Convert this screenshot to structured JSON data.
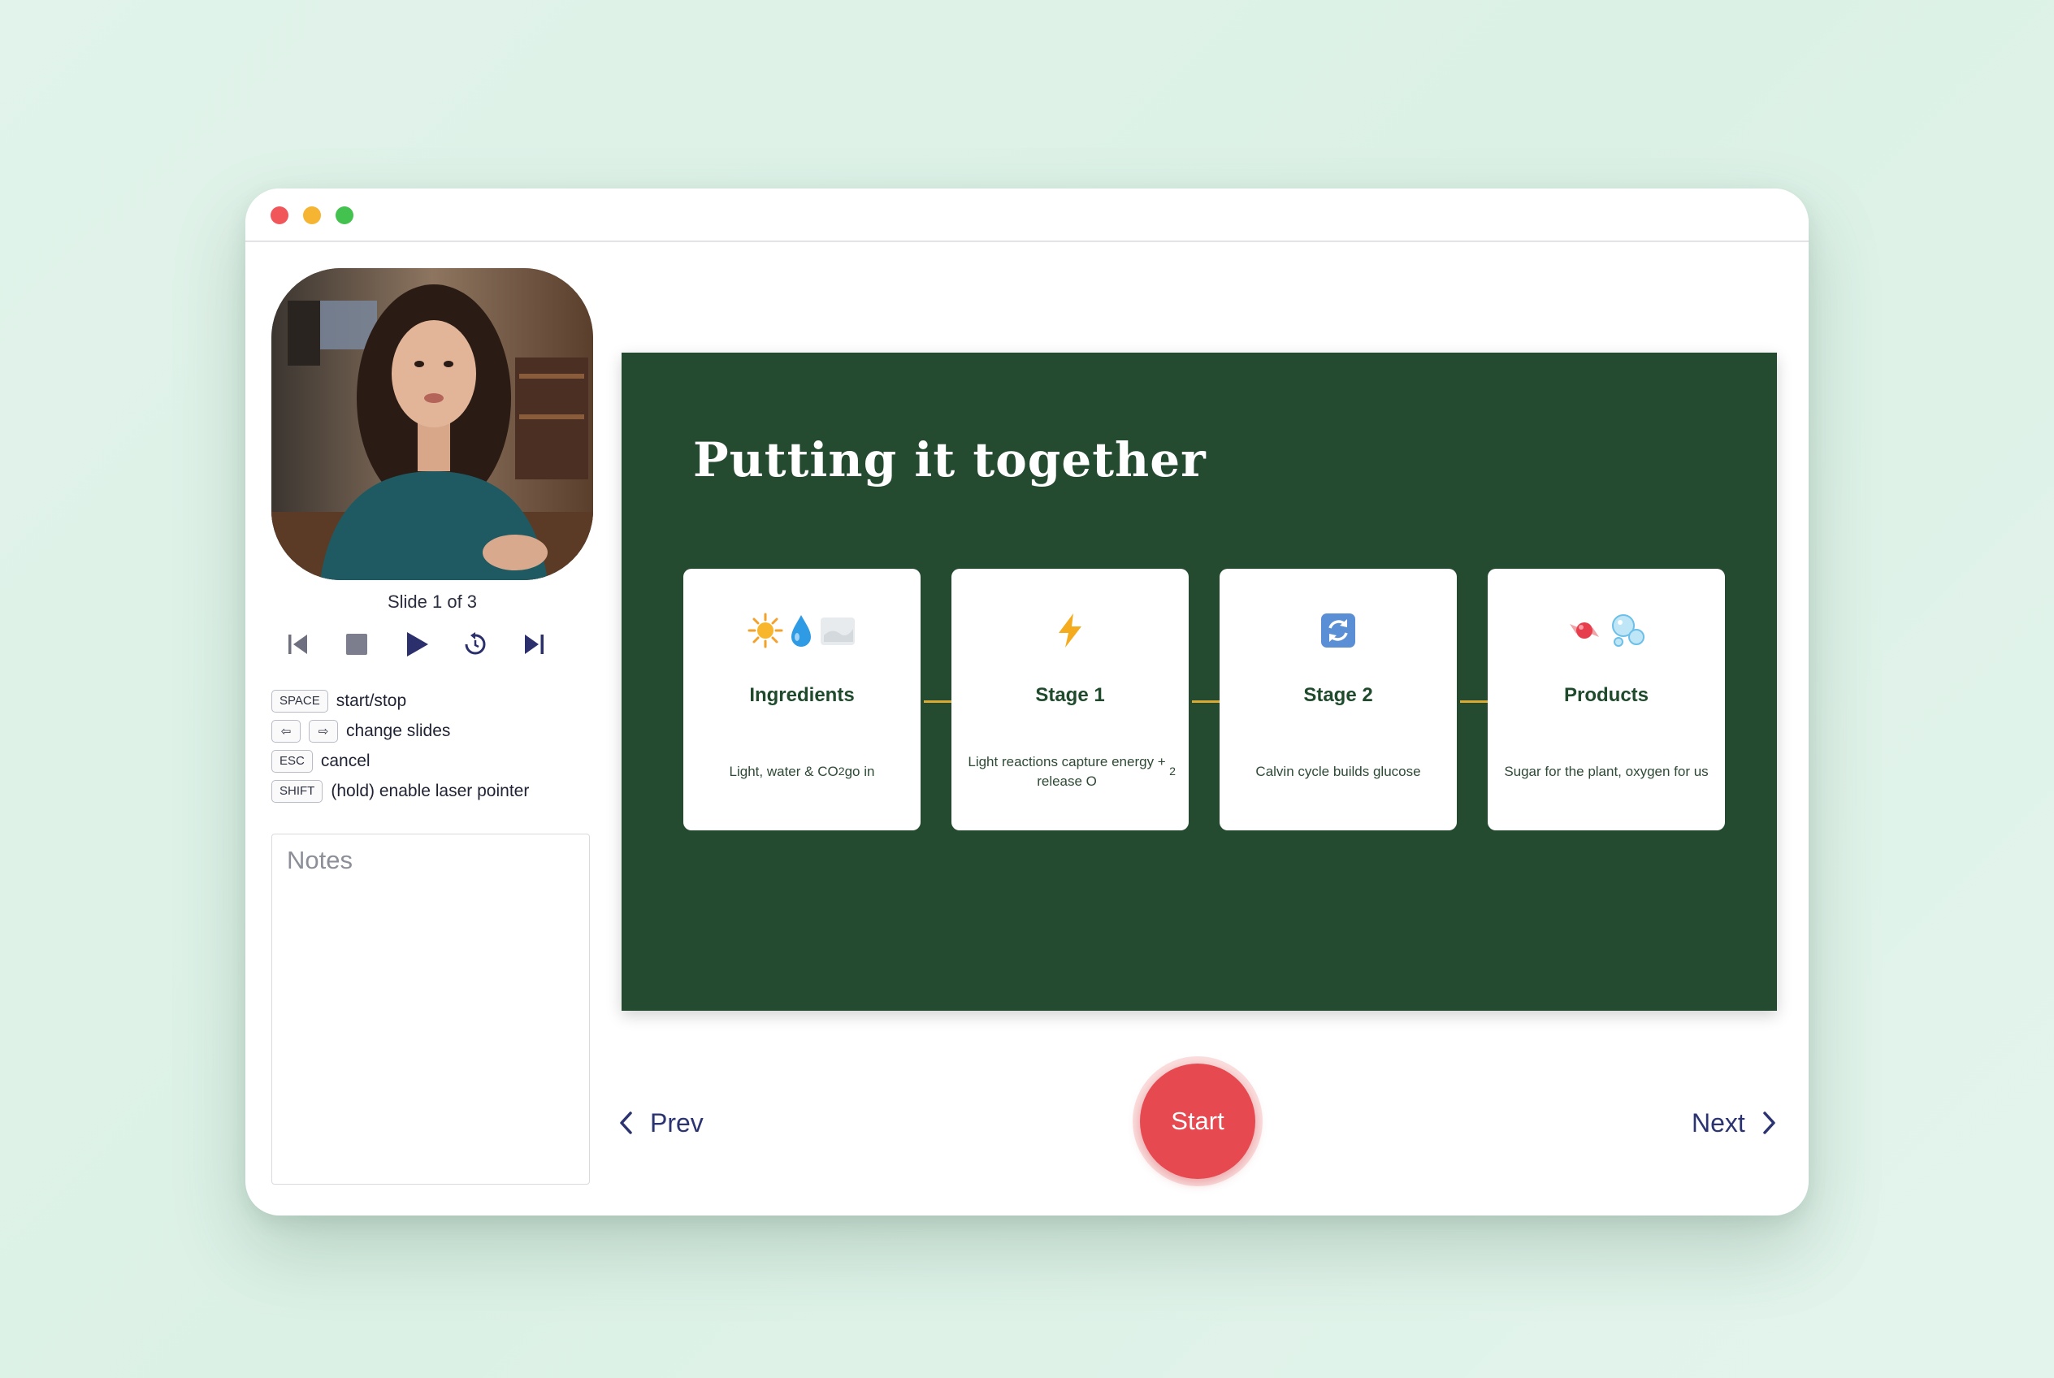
{
  "window": {
    "controls": [
      "close",
      "minimize",
      "maximize"
    ]
  },
  "webcam": {
    "icon": "presenter-video"
  },
  "player": {
    "slide_counter": "Slide 1 of 3",
    "controls": [
      "skip-back-icon",
      "stop-icon",
      "play-icon",
      "restart-icon",
      "skip-forward-icon"
    ],
    "accent_color": "#2b2f6b"
  },
  "shortcuts": [
    {
      "keys": [
        "SPACE"
      ],
      "action": "start/stop"
    },
    {
      "keys": [
        "⇦",
        "⇨"
      ],
      "action": "change slides"
    },
    {
      "keys": [
        "ESC"
      ],
      "action": "cancel"
    },
    {
      "keys": [
        "SHIFT"
      ],
      "action": "(hold) enable laser pointer"
    }
  ],
  "notes": {
    "placeholder": "Notes"
  },
  "slide": {
    "background": "#244b30",
    "title": "Putting it together",
    "connector_color": "#d9a933",
    "cards": [
      {
        "icons": [
          "sun-icon",
          "water-drop-icon",
          "cloud-icon"
        ],
        "title": "Ingredients",
        "desc_html": "Light, water & CO<sub>2</sub> go in"
      },
      {
        "icons": [
          "lightning-icon"
        ],
        "title": "Stage 1",
        "desc_html": "Light reactions capture energy + release O<sub>2</sub>"
      },
      {
        "icons": [
          "cycle-arrows-icon"
        ],
        "title": "Stage 2",
        "desc_html": "Calvin cycle builds glucose"
      },
      {
        "icons": [
          "candy-icon",
          "bubbles-icon"
        ],
        "title": "Products",
        "desc_html": "Sugar for the plant, oxygen for us"
      }
    ]
  },
  "nav": {
    "prev_label": "Prev",
    "next_label": "Next",
    "start_label": "Start",
    "start_color": "#e64a50"
  }
}
